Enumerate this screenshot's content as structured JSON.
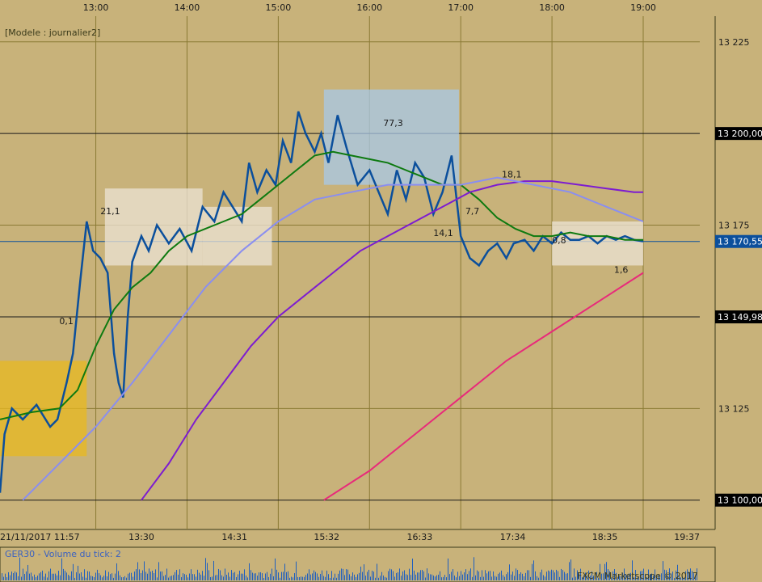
{
  "chart_data": {
    "type": "line",
    "title": "[Modele : journalier2]",
    "top_time_labels": [
      {
        "label": "13:00",
        "t": 13.0
      },
      {
        "label": "14:00",
        "t": 14.0
      },
      {
        "label": "15:00",
        "t": 15.0
      },
      {
        "label": "16:00",
        "t": 16.0
      },
      {
        "label": "17:00",
        "t": 17.0
      },
      {
        "label": "18:00",
        "t": 18.0
      },
      {
        "label": "19:00",
        "t": 19.0
      }
    ],
    "bottom_time_labels": [
      {
        "label": "21/11/2017 11:57",
        "t": 11.95
      },
      {
        "label": "13:30",
        "t": 13.5
      },
      {
        "label": "14:31",
        "t": 14.52
      },
      {
        "label": "15:32",
        "t": 15.53
      },
      {
        "label": "16:33",
        "t": 16.55
      },
      {
        "label": "17:34",
        "t": 17.57
      },
      {
        "label": "18:35",
        "t": 18.58
      },
      {
        "label": "19:37",
        "t": 19.62
      }
    ],
    "y_ticks": [
      {
        "label": "13 225",
        "v": 13225
      },
      {
        "label": "13 175",
        "v": 13175
      },
      {
        "label": "13 125",
        "v": 13125
      }
    ],
    "price_boxes": [
      {
        "label": "13 200,00",
        "v": 13200.0,
        "color": "#000000"
      },
      {
        "label": "13 170,55",
        "v": 13170.55,
        "color": "#0b4f9c"
      },
      {
        "label": "13 149,98",
        "v": 13149.98,
        "color": "#000000"
      },
      {
        "label": "13 100,00",
        "v": 13100.0,
        "color": "#000000"
      }
    ],
    "ylim": [
      13092,
      13232
    ],
    "xlim": [
      11.95,
      19.62
    ],
    "series": [
      {
        "color": "#0b4f9c",
        "points": [
          [
            11.95,
            13102
          ],
          [
            12.0,
            13118
          ],
          [
            12.08,
            13125
          ],
          [
            12.2,
            13122
          ],
          [
            12.35,
            13126
          ],
          [
            12.5,
            13120
          ],
          [
            12.58,
            13122
          ],
          [
            12.68,
            13132
          ],
          [
            12.75,
            13140
          ],
          [
            12.83,
            13160
          ],
          [
            12.9,
            13176
          ],
          [
            12.97,
            13168
          ],
          [
            13.05,
            13166
          ],
          [
            13.13,
            13162
          ],
          [
            13.2,
            13140
          ],
          [
            13.25,
            13132
          ],
          [
            13.3,
            13128
          ],
          [
            13.35,
            13150
          ],
          [
            13.4,
            13165
          ],
          [
            13.5,
            13172
          ],
          [
            13.58,
            13168
          ],
          [
            13.67,
            13175
          ],
          [
            13.8,
            13170
          ],
          [
            13.92,
            13174
          ],
          [
            14.05,
            13168
          ],
          [
            14.17,
            13180
          ],
          [
            14.3,
            13176
          ],
          [
            14.4,
            13184
          ],
          [
            14.5,
            13180
          ],
          [
            14.6,
            13176
          ],
          [
            14.68,
            13192
          ],
          [
            14.77,
            13184
          ],
          [
            14.87,
            13190
          ],
          [
            14.97,
            13186
          ],
          [
            15.05,
            13198
          ],
          [
            15.14,
            13192
          ],
          [
            15.22,
            13206
          ],
          [
            15.3,
            13200
          ],
          [
            15.4,
            13195
          ],
          [
            15.47,
            13200
          ],
          [
            15.55,
            13192
          ],
          [
            15.65,
            13205
          ],
          [
            15.75,
            13196
          ],
          [
            15.87,
            13186
          ],
          [
            16.0,
            13190
          ],
          [
            16.1,
            13184
          ],
          [
            16.2,
            13178
          ],
          [
            16.3,
            13190
          ],
          [
            16.4,
            13182
          ],
          [
            16.5,
            13192
          ],
          [
            16.6,
            13188
          ],
          [
            16.7,
            13178
          ],
          [
            16.8,
            13184
          ],
          [
            16.9,
            13194
          ],
          [
            17.0,
            13172
          ],
          [
            17.1,
            13166
          ],
          [
            17.2,
            13164
          ],
          [
            17.3,
            13168
          ],
          [
            17.4,
            13170
          ],
          [
            17.5,
            13166
          ],
          [
            17.58,
            13170
          ],
          [
            17.7,
            13171
          ],
          [
            17.8,
            13168
          ],
          [
            17.9,
            13172
          ],
          [
            18.0,
            13170
          ],
          [
            18.1,
            13173
          ],
          [
            18.2,
            13171
          ],
          [
            18.3,
            13171
          ],
          [
            18.4,
            13172
          ],
          [
            18.5,
            13170
          ],
          [
            18.6,
            13172
          ],
          [
            18.7,
            13171
          ],
          [
            18.8,
            13172
          ],
          [
            18.9,
            13171
          ],
          [
            19.0,
            13170.55
          ]
        ]
      },
      {
        "color": "#0e7a10",
        "points": [
          [
            11.95,
            13122
          ],
          [
            12.3,
            13124
          ],
          [
            12.6,
            13125
          ],
          [
            12.8,
            13130
          ],
          [
            13.0,
            13142
          ],
          [
            13.2,
            13152
          ],
          [
            13.4,
            13158
          ],
          [
            13.6,
            13162
          ],
          [
            13.8,
            13168
          ],
          [
            14.0,
            13172
          ],
          [
            14.2,
            13174
          ],
          [
            14.4,
            13176
          ],
          [
            14.6,
            13178
          ],
          [
            14.8,
            13182
          ],
          [
            15.0,
            13186
          ],
          [
            15.2,
            13190
          ],
          [
            15.4,
            13194
          ],
          [
            15.6,
            13195
          ],
          [
            15.8,
            13194
          ],
          [
            16.0,
            13193
          ],
          [
            16.2,
            13192
          ],
          [
            16.4,
            13190
          ],
          [
            16.6,
            13188
          ],
          [
            16.8,
            13186
          ],
          [
            17.0,
            13186
          ],
          [
            17.2,
            13182
          ],
          [
            17.4,
            13177
          ],
          [
            17.6,
            13174
          ],
          [
            17.8,
            13172
          ],
          [
            18.0,
            13172
          ],
          [
            18.2,
            13173
          ],
          [
            18.4,
            13172
          ],
          [
            18.6,
            13172
          ],
          [
            18.8,
            13171
          ],
          [
            19.0,
            13171
          ]
        ]
      },
      {
        "color": "#7d1cd0",
        "points": [
          [
            13.5,
            13100
          ],
          [
            13.8,
            13110
          ],
          [
            14.1,
            13122
          ],
          [
            14.4,
            13132
          ],
          [
            14.7,
            13142
          ],
          [
            15.0,
            13150
          ],
          [
            15.3,
            13156
          ],
          [
            15.6,
            13162
          ],
          [
            15.9,
            13168
          ],
          [
            16.2,
            13172
          ],
          [
            16.5,
            13176
          ],
          [
            16.8,
            13180
          ],
          [
            17.1,
            13184
          ],
          [
            17.4,
            13186
          ],
          [
            17.7,
            13187
          ],
          [
            18.0,
            13187
          ],
          [
            18.3,
            13186
          ],
          [
            18.6,
            13185
          ],
          [
            18.9,
            13184
          ],
          [
            19.0,
            13184
          ]
        ]
      },
      {
        "color": "#e82a7a",
        "points": [
          [
            15.5,
            13100
          ],
          [
            16.0,
            13108
          ],
          [
            16.5,
            13118
          ],
          [
            17.0,
            13128
          ],
          [
            17.5,
            13138
          ],
          [
            18.0,
            13146
          ],
          [
            18.5,
            13154
          ],
          [
            19.0,
            13162
          ]
        ]
      },
      {
        "color": "#8a8ef0",
        "points": [
          [
            12.2,
            13100
          ],
          [
            12.6,
            13110
          ],
          [
            13.0,
            13120
          ],
          [
            13.4,
            13132
          ],
          [
            13.8,
            13145
          ],
          [
            14.2,
            13158
          ],
          [
            14.6,
            13168
          ],
          [
            15.0,
            13176
          ],
          [
            15.4,
            13182
          ],
          [
            15.8,
            13184
          ],
          [
            16.2,
            13186
          ],
          [
            16.6,
            13186
          ],
          [
            17.0,
            13186
          ],
          [
            17.4,
            13188
          ],
          [
            17.8,
            13186
          ],
          [
            18.2,
            13184
          ],
          [
            18.6,
            13180
          ],
          [
            19.0,
            13176
          ]
        ]
      }
    ],
    "boxes": [
      {
        "t0": 11.95,
        "t1": 12.9,
        "v0": 13112,
        "v1": 13138,
        "color": "#e8b820"
      },
      {
        "t0": 13.1,
        "t1": 14.17,
        "v0": 13164,
        "v1": 13185,
        "color": "#ece3d6"
      },
      {
        "t0": 14.17,
        "t1": 14.93,
        "v0": 13164,
        "v1": 13180,
        "color": "#ece3d6"
      },
      {
        "t0": 15.5,
        "t1": 16.98,
        "v0": 13186,
        "v1": 13212,
        "color": "#a8c8e8"
      },
      {
        "t0": 18.0,
        "t1": 19.0,
        "v0": 13164,
        "v1": 13176,
        "color": "#ece3d6"
      }
    ],
    "level_labels": [
      {
        "label": "21,1",
        "t": 13.05,
        "v": 13178
      },
      {
        "label": "0,1",
        "t": 12.6,
        "v": 13148
      },
      {
        "label": "77,3",
        "t": 16.15,
        "v": 13202
      },
      {
        "label": "14,1",
        "t": 16.7,
        "v": 13172
      },
      {
        "label": "7,7",
        "t": 17.05,
        "v": 13178
      },
      {
        "label": "18,1",
        "t": 17.45,
        "v": 13188
      },
      {
        "label": "0,8",
        "t": 18.0,
        "v": 13170
      },
      {
        "label": "1,6",
        "t": 18.68,
        "v": 13162
      }
    ],
    "volume_label": "GER30 - Volume du tick: 2",
    "credit": "FXCM Marketscope © 2017"
  }
}
